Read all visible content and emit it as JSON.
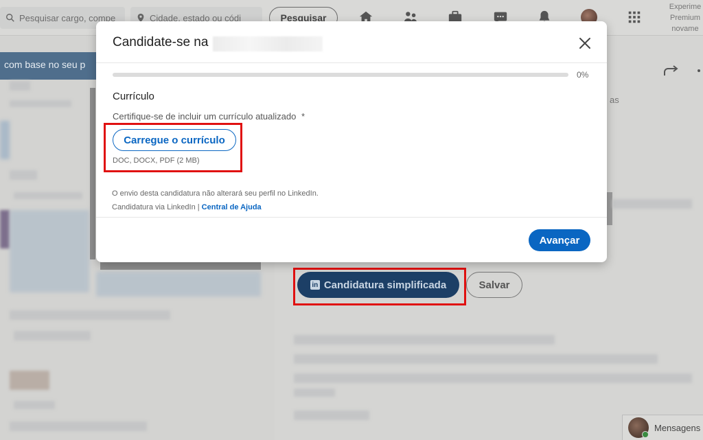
{
  "header": {
    "search_placeholder": "Pesquisar cargo, compe",
    "location_placeholder": "Cidade, estado ou códi",
    "search_button": "Pesquisar",
    "premium_text": "Experime Premium novame"
  },
  "background": {
    "banner_text": "com base no seu p",
    "side_text": "as",
    "apply_button": "Candidatura simplificada",
    "save_button": "Salvar",
    "messaging_label": "Mensagens"
  },
  "modal": {
    "title": "Candidate-se na",
    "progress": 0,
    "progress_label": "0%",
    "section_title": "Currículo",
    "field_label": "Certifique-se de incluir um currículo atualizado",
    "required_mark": "*",
    "upload_button": "Carregue o currículo",
    "file_hint": "DOC, DOCX, PDF (2 MB)",
    "note_profile": "O envio desta candidatura não alterará seu perfil no LinkedIn.",
    "note_via": "Candidatura via LinkedIn |",
    "help_link": "Central de Ajuda",
    "next_button": "Avançar"
  },
  "colors": {
    "accent": "#0a66c2",
    "highlight": "#e01010"
  }
}
